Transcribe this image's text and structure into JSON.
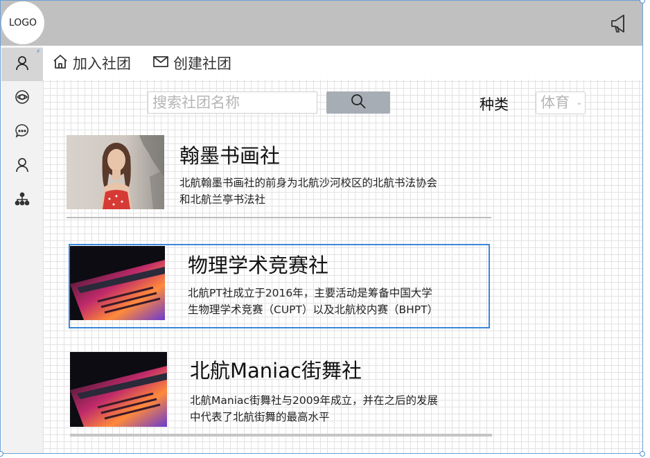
{
  "header": {
    "logo_text": "LOGO",
    "announce_icon": "megaphone-icon"
  },
  "sidebar": {
    "items": [
      {
        "icon": "user-icon",
        "active": true
      },
      {
        "icon": "eye-icon",
        "active": false
      },
      {
        "icon": "chat-icon",
        "active": false
      },
      {
        "icon": "user-icon",
        "active": false
      },
      {
        "icon": "org-chart-icon",
        "active": false
      }
    ],
    "pin_icon": "bolt-icon"
  },
  "menu": {
    "join_label": "加入社团",
    "create_label": "创建社团"
  },
  "search": {
    "placeholder": "搜索社团名称",
    "button_icon": "search-icon",
    "category_label": "种类",
    "category_value": "体育"
  },
  "clubs": [
    {
      "title": "翰墨书画社",
      "desc_line1": "北航翰墨书画社的前身为北航沙河校区的北航书法协会",
      "desc_line2": "和北航兰亭书法社"
    },
    {
      "title": "物理学术竞赛社",
      "desc_line1": "北航PT社成立于2016年，主要活动是筹备中国大学",
      "desc_line2": "生物理学术竞赛（CUPT）以及北航校内赛（BHPT）"
    },
    {
      "title": "北航Maniac街舞社",
      "desc_line1": "北航Maniac街舞社与2009年成立，并在之后的发展",
      "desc_line2": "中代表了北航街舞的最高水平"
    }
  ],
  "colors": {
    "topbar": "#c0c0c0",
    "sidebar": "#f2f2f2",
    "selection": "#3a86db",
    "search_button": "#a6adb5"
  }
}
